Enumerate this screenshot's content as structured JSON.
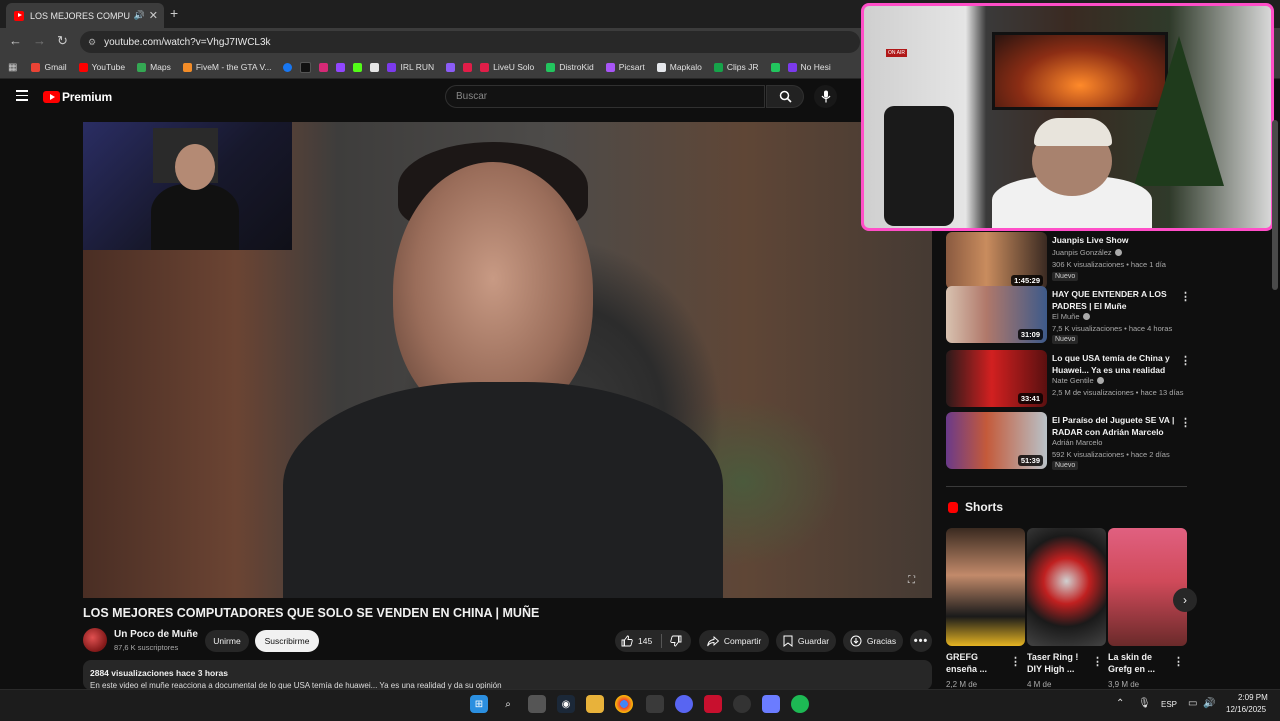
{
  "browser": {
    "tab_title": "LOS MEJORES COMPUTAD",
    "url": "youtube.com/watch?v=VhgJ7IWCL3k",
    "bookmarks": [
      {
        "label": "Gmail",
        "color": "#ea4335"
      },
      {
        "label": "YouTube",
        "color": "#ff0000"
      },
      {
        "label": "Maps",
        "color": "#34a853"
      },
      {
        "label": "FiveM - the GTA V...",
        "color": "#f28c28"
      },
      {
        "label": "IRL RUN",
        "color": "#7c3aed"
      },
      {
        "label": "LiveU Solo",
        "color": "#e11d48"
      },
      {
        "label": "DistroKid",
        "color": "#22c55e"
      },
      {
        "label": "Picsart",
        "color": "#a855f7"
      },
      {
        "label": "Mapkalo",
        "color": "#e5e7eb"
      },
      {
        "label": "Clips JR",
        "color": "#16a34a"
      },
      {
        "label": "No Hesi",
        "color": "#7c3aed"
      }
    ]
  },
  "youtube": {
    "brand": "Premium",
    "search_placeholder": "Buscar"
  },
  "stream": {
    "on_air": "ON AIR"
  },
  "video": {
    "title": "LOS MEJORES COMPUTADORES QUE SOLO SE VENDEN EN CHINA | MUÑE",
    "channel": "Un Poco de Muñe",
    "subscribers": "87,6 K suscriptores",
    "join_label": "Unirme",
    "subscribe_label": "Suscribirme",
    "likes": "145",
    "share_label": "Compartir",
    "save_label": "Guardar",
    "thanks_label": "Gracias",
    "description_meta": "2884 visualizaciones  hace 3 horas",
    "description_text": "En este video el muñe reacciona a documental de lo que USA temía de huawei... Ya es una realidad y da su opinión"
  },
  "recommendations": [
    {
      "title": "Juanpis Live Show",
      "channel": "Juanpis González",
      "views": "306 K visualizaciones • hace 1 día",
      "badge": "Nuevo",
      "duration": "1:45:29"
    },
    {
      "title": "HAY QUE ENTENDER A LOS PADRES | El Muñe",
      "channel": "El Muñe",
      "views": "7,5 K visualizaciones • hace 4 horas",
      "badge": "Nuevo",
      "duration": "31:09"
    },
    {
      "title": "Lo que USA temía de China y Huawei... Ya es una realidad",
      "channel": "Nate Gentile",
      "views": "2,5 M de visualizaciones • hace 13 días",
      "badge": "",
      "duration": "33:41"
    },
    {
      "title": "El Paraíso del Juguete SE VA | RADAR con Adrián Marcelo",
      "channel": "Adrián Marcelo",
      "views": "592 K visualizaciones • hace 2 días",
      "badge": "Nuevo",
      "duration": "51:39"
    }
  ],
  "shorts": {
    "heading": "Shorts",
    "items": [
      {
        "title": "GREFG enseña ...",
        "views": "2,2 M de"
      },
      {
        "title": "Taser Ring ! DIY High ...",
        "views": "4 M de"
      },
      {
        "title": "La skin de Grefg en ...",
        "views": "3,9 M de"
      }
    ]
  },
  "taskbar": {
    "language": "ESP",
    "time": "2:09 PM",
    "date": "12/16/2025"
  }
}
